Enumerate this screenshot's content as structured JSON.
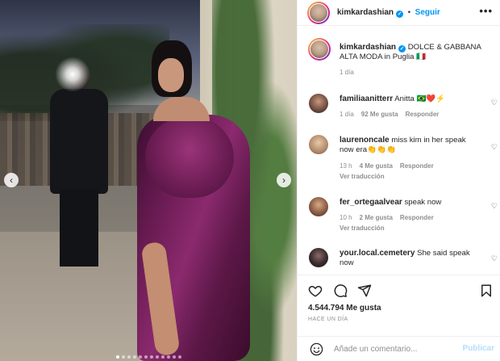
{
  "post": {
    "author": "kimkardashian",
    "follow_label": "Seguir",
    "more_label": "•••",
    "caption_text": "DOLCE & GABBANA ALTA MODA in Puglia 🇮🇹",
    "caption_time": "1 día",
    "likes": "4.544.794 Me gusta",
    "date": "HACE UN DÍA"
  },
  "photo": {
    "prev_icon": "chevron-left-icon",
    "next_icon": "chevron-right-icon",
    "prev_glyph": "‹",
    "next_glyph": "›",
    "dot_count": 12,
    "active_dot": 0
  },
  "comments": [
    {
      "user": "familiaanitterr",
      "text": "Anitta 🇧🇷❤️⚡",
      "time": "1 día",
      "likes": "92 Me gusta",
      "reply": "Responder",
      "translate": ""
    },
    {
      "user": "laurenoncale",
      "text": "miss kim in her speak now era👏👏👏",
      "time": "13 h",
      "likes": "4 Me gusta",
      "reply": "Responder",
      "translate": "Ver traducción"
    },
    {
      "user": "fer_ortegaalvear",
      "text": "speak now",
      "time": "10 h",
      "likes": "2 Me gusta",
      "reply": "Responder",
      "translate": "Ver traducción"
    },
    {
      "user": "your.local.cemetery",
      "text": "She said speak now",
      "time": "",
      "likes": "",
      "reply": "",
      "translate": ""
    }
  ],
  "actions": {
    "like_icon": "heart-icon",
    "comment_icon": "comment-icon",
    "share_icon": "share-icon",
    "save_icon": "bookmark-icon"
  },
  "composer": {
    "emoji_icon": "smiley-icon",
    "placeholder": "Añade un comentario...",
    "post_label": "Publicar"
  },
  "colors": {
    "accent": "#0095f6",
    "muted": "#8e8e8e",
    "text": "#262626",
    "post_disabled": "#b2dffc"
  }
}
